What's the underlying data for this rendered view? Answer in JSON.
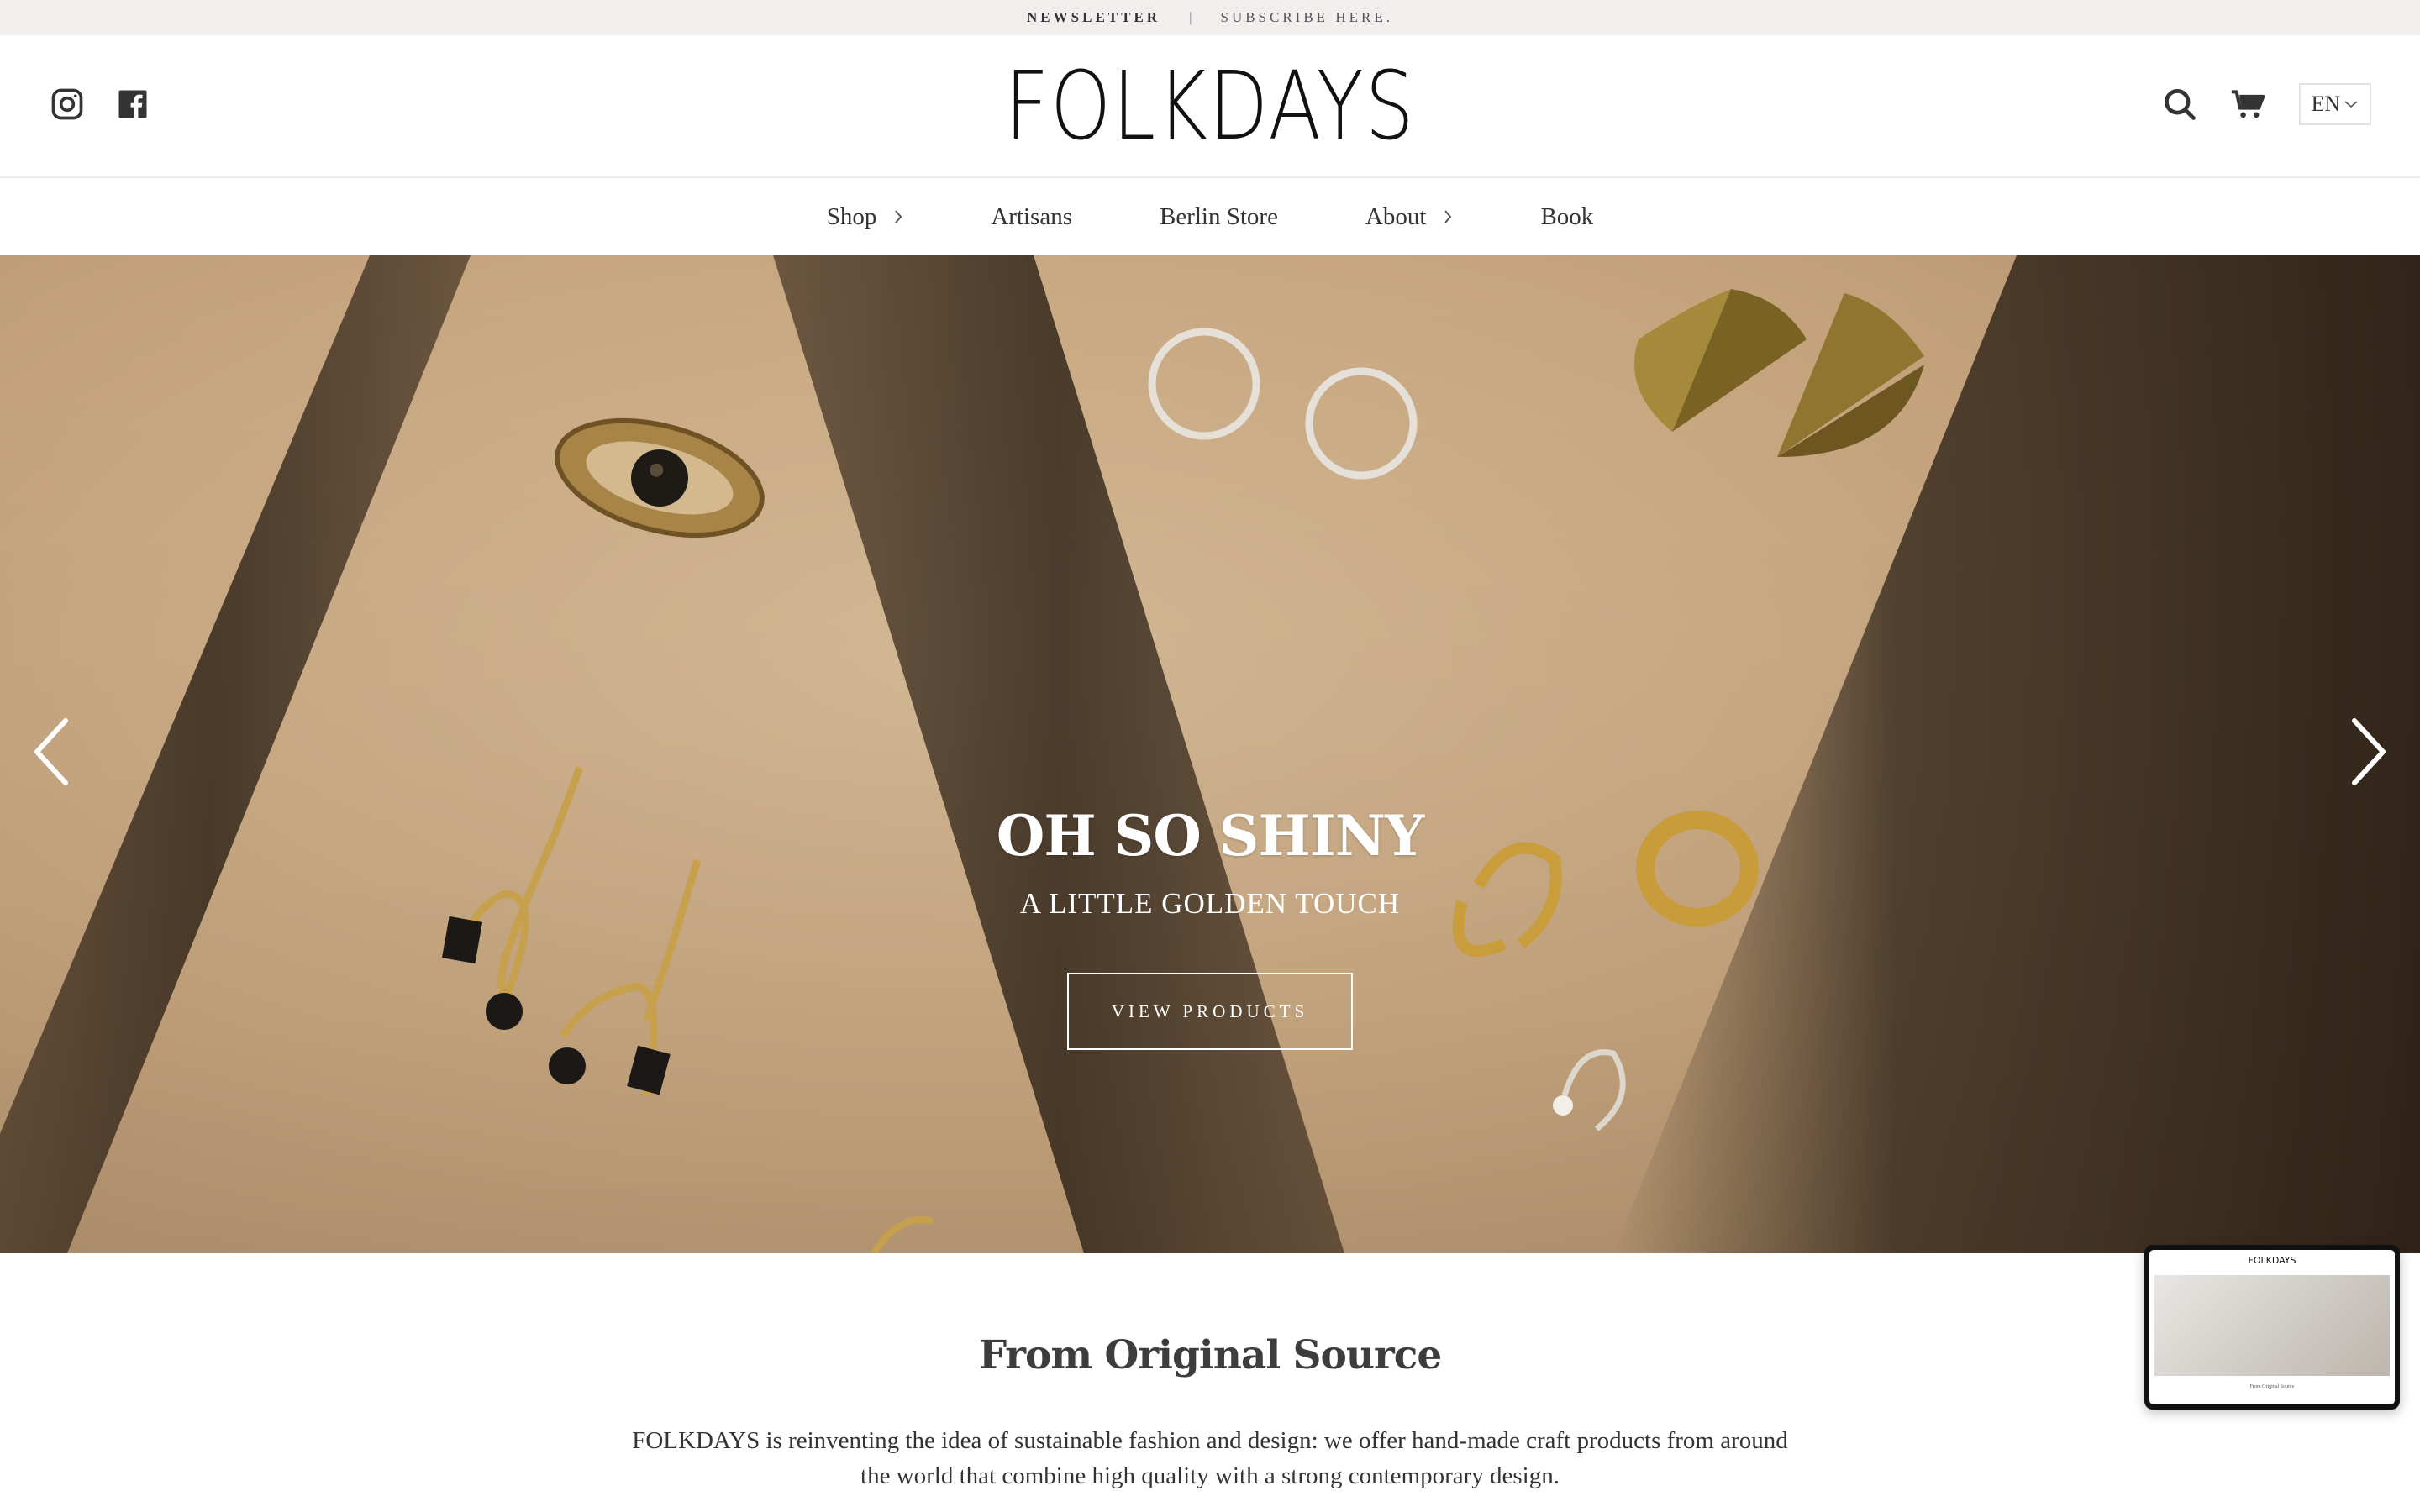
{
  "newsletter_bar": {
    "label": "NEWSLETTER",
    "separator": "|",
    "cta": "SUBSCRIBE HERE."
  },
  "header": {
    "logo_text": "FOLKDAYS",
    "social_icons": [
      "instagram-icon",
      "facebook-icon"
    ],
    "utility_icons": [
      "search-icon",
      "cart-icon"
    ],
    "language": "EN"
  },
  "nav": {
    "items": [
      {
        "label": "Shop",
        "has_submenu": true
      },
      {
        "label": "Artisans",
        "has_submenu": false
      },
      {
        "label": "Berlin Store",
        "has_submenu": false
      },
      {
        "label": "About",
        "has_submenu": true
      },
      {
        "label": "Book",
        "has_submenu": false
      }
    ]
  },
  "hero": {
    "title": "OH SO SHINY",
    "subtitle": "A LITTLE GOLDEN TOUCH",
    "button_label": "VIEW PRODUCTS",
    "prev_icon": "chevron-left-icon",
    "next_icon": "chevron-right-icon"
  },
  "intro": {
    "title": "From Original Source",
    "body": "FOLKDAYS is reinventing the idea of sustainable fashion and design: we offer hand-made craft products from around the world that combine high quality with a strong contemporary design."
  },
  "preview": {
    "logo_text": "FOLKDAYS",
    "caption": "From Original Source"
  },
  "colors": {
    "topbar_bg": "#f1eeed",
    "text": "#333333",
    "hero_sand": "#c5a47d",
    "white": "#ffffff"
  }
}
